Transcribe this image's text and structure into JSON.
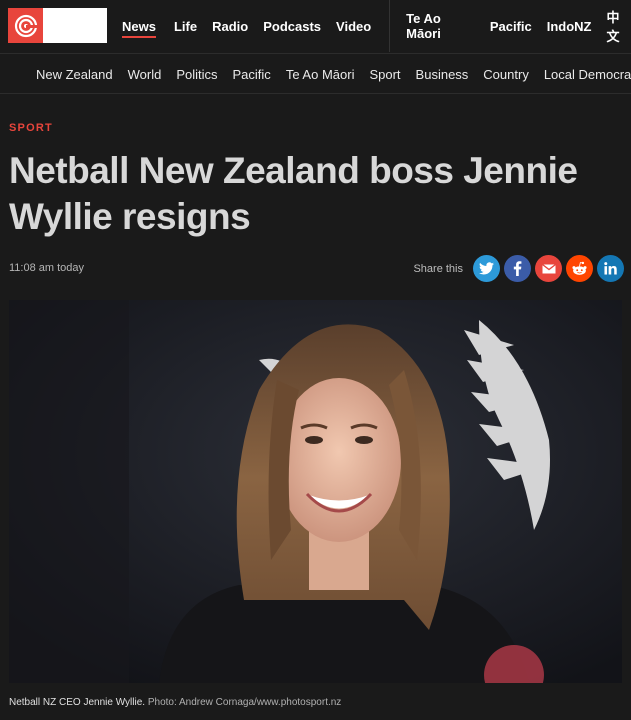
{
  "brand": {
    "colors": {
      "accent": "#e8453c",
      "twitter": "#2d9ad9",
      "facebook": "#3b5ca8",
      "email": "#e8453c",
      "reddit": "#ff4500",
      "linkedin": "#1477b4"
    }
  },
  "top_nav": {
    "items": [
      {
        "label": "News",
        "active": true
      },
      {
        "label": "Life"
      },
      {
        "label": "Radio"
      },
      {
        "label": "Podcasts"
      },
      {
        "label": "Video"
      }
    ],
    "secondary": [
      {
        "label": "Te Ao Māori"
      },
      {
        "label": "Pacific"
      },
      {
        "label": "IndoNZ"
      },
      {
        "label": "中文"
      }
    ]
  },
  "section_nav": {
    "items": [
      {
        "label": "New Zealand"
      },
      {
        "label": "World"
      },
      {
        "label": "Politics"
      },
      {
        "label": "Pacific"
      },
      {
        "label": "Te Ao Māori"
      },
      {
        "label": "Sport",
        "active": true
      },
      {
        "label": "Business"
      },
      {
        "label": "Country"
      },
      {
        "label": "Local Democracy Reporting"
      }
    ]
  },
  "article": {
    "kicker": "SPORT",
    "headline": "Netball New Zealand boss Jennie Wyllie resigns",
    "timestamp": "11:08 am today",
    "share_label": "Share this",
    "share_icons": [
      "twitter-icon",
      "facebook-icon",
      "email-icon",
      "reddit-icon",
      "linkedin-icon"
    ],
    "caption_text": "Netball NZ CEO Jennie Wyllie.",
    "caption_credit": "Photo: Andrew Cornaga/www.photosport.nz"
  }
}
